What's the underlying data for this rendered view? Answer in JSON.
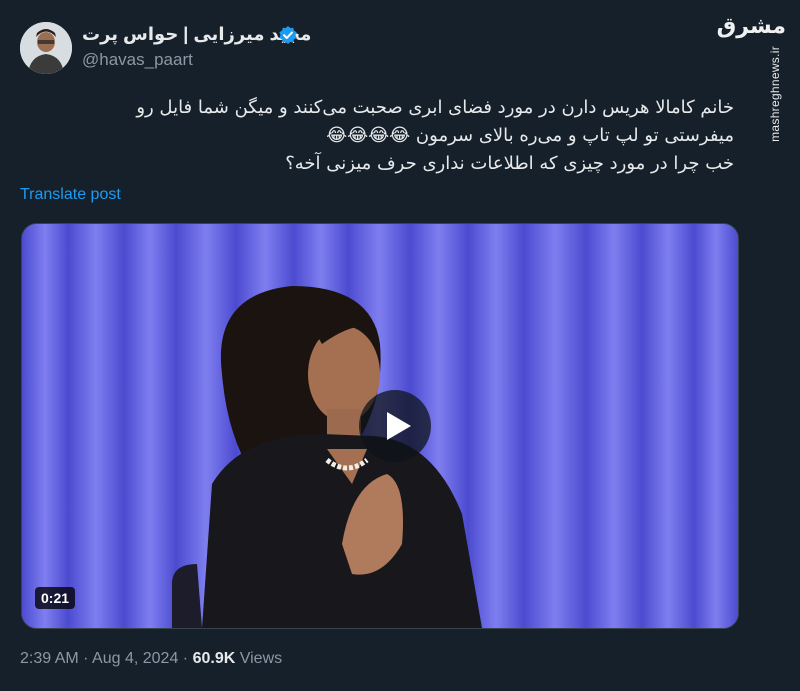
{
  "tweet": {
    "display_name": "مجید میرزایی | حواس پرت",
    "handle": "@havas_paart",
    "text_lines": [
      "خانم کامالا هریس دارن در مورد فضای ابری صحبت می‌کنند و میگن شما فایل رو",
      "میفرستی تو لپ تاپ و می‌ره بالای سرمون 😂😂😂😂",
      "خب چرا در مورد چیزی که اطلاعات نداری حرف میزنی آخه؟"
    ],
    "translate_label": "Translate post",
    "media": {
      "duration": "0:21"
    },
    "time": "2:39 AM",
    "separator": "·",
    "date": "Aug 4, 2024",
    "views_count": "60.9K",
    "views_label": "Views"
  },
  "watermark": {
    "logo": "مشرق",
    "site": "mashreghnews.ir"
  },
  "icons": {
    "verified": "verified-badge-icon",
    "play": "play-icon"
  },
  "colors": {
    "background": "#15202b",
    "link": "#1d9bf0",
    "verified": "#1d9bf0",
    "secondary_text": "#8b98a5"
  }
}
